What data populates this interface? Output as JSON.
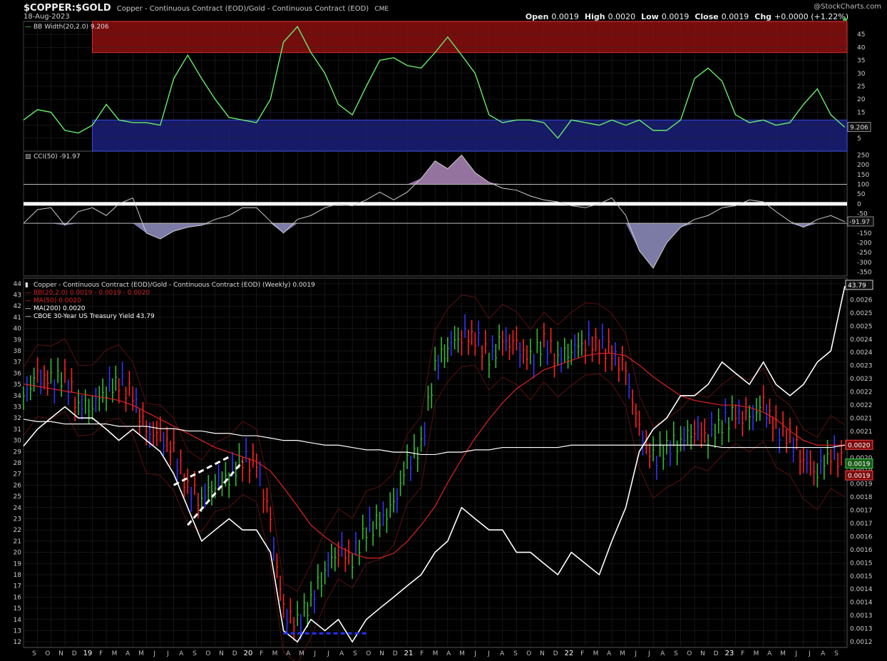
{
  "header": {
    "symbol": "$COPPER:$GOLD",
    "description": "Copper - Continuous Contract (EOD)/Gold - Continuous Contract (EOD)",
    "exchange": "CME",
    "date": "18-Aug-2023",
    "watermark": "@StockCharts.com",
    "quote": [
      {
        "label": "Open",
        "value": "0.0019"
      },
      {
        "label": "High",
        "value": "0.0020"
      },
      {
        "label": "Low",
        "value": "0.0019"
      },
      {
        "label": "Close",
        "value": "0.0019"
      },
      {
        "label": "Chg",
        "value": "+0.0000 (+1.22%)"
      }
    ]
  },
  "colors": {
    "background": "#000000",
    "grid": "#2a2a2a",
    "bbwidth_line": "#66ee66",
    "red_zone": "#8b1010",
    "blue_zone": "#1a1f7a",
    "cci_fill": "#8a88b8",
    "cci_line": "#cccccc",
    "bar_up": "#33bb33",
    "bar_down": "#ff2222",
    "bar_neutral": "#3333ff",
    "ma50": "#dd2222",
    "ma200": "#ffffff",
    "tyx": "#ffffff",
    "bbands": "#5a1010"
  },
  "chart_data": [
    {
      "type": "line",
      "panel": "BB Width",
      "legend": "BB Width(20,2.0) 9.206",
      "last_label": "9.206",
      "ylim": [
        0,
        50
      ],
      "yticks": [
        "5",
        "10",
        "15",
        "20",
        "25",
        "30",
        "35",
        "40",
        "45"
      ],
      "zones": [
        {
          "name": "high-volatility",
          "from": 38,
          "to": 50,
          "start_date": "2019-01"
        },
        {
          "name": "low-volatility",
          "from": 0,
          "to": 12,
          "start_date": "2019-01"
        }
      ],
      "series": [
        {
          "x": [
            "2018-08",
            "2018-09",
            "2018-10",
            "2018-11",
            "2018-12",
            "2019-01",
            "2019-02",
            "2019-03",
            "2019-04",
            "2019-05",
            "2019-06",
            "2019-07",
            "2019-08",
            "2019-09",
            "2019-10",
            "2019-11",
            "2019-12",
            "2020-01",
            "2020-02",
            "2020-03",
            "2020-04",
            "2020-05",
            "2020-06",
            "2020-07",
            "2020-08",
            "2020-09",
            "2020-10",
            "2020-11",
            "2020-12",
            "2021-01",
            "2021-02",
            "2021-03",
            "2021-04",
            "2021-05",
            "2021-06",
            "2021-07",
            "2021-08",
            "2021-09",
            "2021-10",
            "2021-11",
            "2021-12",
            "2022-01",
            "2022-02",
            "2022-03",
            "2022-04",
            "2022-05",
            "2022-06",
            "2022-07",
            "2022-08",
            "2022-09",
            "2022-10",
            "2022-11",
            "2022-12",
            "2023-01",
            "2023-02",
            "2023-03",
            "2023-04",
            "2023-05",
            "2023-06",
            "2023-07",
            "2023-08"
          ],
          "values": [
            12,
            16,
            15,
            8,
            7,
            10,
            18,
            12,
            11,
            11,
            10,
            28,
            37,
            28,
            20,
            13,
            12,
            11,
            20,
            42,
            48,
            38,
            30,
            18,
            14,
            25,
            35,
            36,
            33,
            32,
            38,
            44,
            37,
            30,
            14,
            11,
            12,
            12,
            11,
            5,
            12,
            11,
            10,
            12,
            10,
            12,
            8,
            8,
            12,
            28,
            32,
            27,
            14,
            11,
            12,
            10,
            11,
            18,
            24,
            14,
            9.206
          ]
        }
      ]
    },
    {
      "type": "area",
      "panel": "CCI",
      "legend": "CCI(50) -91.97",
      "last_label": "-91.97",
      "ylim": [
        -370,
        270
      ],
      "yticks": [
        "250",
        "200",
        "150",
        "100",
        "50",
        "0",
        "-50",
        "-100",
        "-150",
        "-200",
        "-250",
        "-300",
        "-350"
      ],
      "reference_lines": [
        100,
        0,
        -100
      ],
      "series": [
        {
          "x": [
            "2018-08",
            "2018-09",
            "2018-10",
            "2018-11",
            "2018-12",
            "2019-01",
            "2019-02",
            "2019-03",
            "2019-04",
            "2019-05",
            "2019-06",
            "2019-07",
            "2019-08",
            "2019-09",
            "2019-10",
            "2019-11",
            "2019-12",
            "2020-01",
            "2020-02",
            "2020-03",
            "2020-04",
            "2020-05",
            "2020-06",
            "2020-07",
            "2020-08",
            "2020-09",
            "2020-10",
            "2020-11",
            "2020-12",
            "2021-01",
            "2021-02",
            "2021-03",
            "2021-04",
            "2021-05",
            "2021-06",
            "2021-07",
            "2021-08",
            "2021-09",
            "2021-10",
            "2021-11",
            "2021-12",
            "2022-01",
            "2022-02",
            "2022-03",
            "2022-04",
            "2022-05",
            "2022-06",
            "2022-07",
            "2022-08",
            "2022-09",
            "2022-10",
            "2022-11",
            "2022-12",
            "2023-01",
            "2023-02",
            "2023-03",
            "2023-04",
            "2023-05",
            "2023-06",
            "2023-07",
            "2023-08"
          ],
          "values": [
            -100,
            -30,
            -20,
            -110,
            -40,
            -20,
            -60,
            0,
            30,
            -150,
            -180,
            -140,
            -120,
            -110,
            -80,
            -60,
            -20,
            -20,
            -90,
            -150,
            -80,
            -60,
            -20,
            0,
            -10,
            20,
            60,
            20,
            60,
            130,
            220,
            180,
            250,
            160,
            110,
            80,
            70,
            40,
            20,
            10,
            -10,
            -20,
            0,
            30,
            -60,
            -240,
            -330,
            -200,
            -120,
            -80,
            -60,
            -20,
            -10,
            20,
            10,
            -40,
            -90,
            -120,
            -80,
            -60,
            -91.97
          ]
        }
      ]
    },
    {
      "type": "bar",
      "panel": "Price",
      "legend": [
        {
          "text": "Copper - Continuous Contract (EOD)/Gold - Continuous Contract (EOD) (Weekly) 0.0019",
          "color": "#dddddd"
        },
        {
          "text": "BB(20,2.0) 0.0019 - 0.0019 - 0.0020",
          "color": "#cc2222"
        },
        {
          "text": "MA(50) 0.0020",
          "color": "#dd2222"
        },
        {
          "text": "MA(200) 0.0020",
          "color": "#ffffff"
        },
        {
          "text": "CBOE 30-Year US Treasury Yield 43.79",
          "color": "#ffffff"
        }
      ],
      "ylim_right": [
        0.00115,
        0.00272
      ],
      "right_ticks": [
        "0.0026",
        "0.0026",
        "0.0025",
        "0.0025",
        "0.0024",
        "0.0024",
        "0.0023",
        "0.0023",
        "0.0022",
        "0.0022",
        "0.0021",
        "0.0021",
        "0.0020",
        "0.0020",
        "0.0019",
        "0.0019",
        "0.0018",
        "0.0017",
        "0.0017",
        "0.0016",
        "0.0016",
        "0.0015",
        "0.0015",
        "0.0014",
        "0.0014",
        "0.0013",
        "0.0013",
        "0.0012"
      ],
      "ylim_left": [
        11.5,
        44.5
      ],
      "left_ticks": [
        "12",
        "13",
        "14",
        "15",
        "16",
        "17",
        "18",
        "19",
        "20",
        "21",
        "22",
        "23",
        "24",
        "25",
        "26",
        "27",
        "28",
        "29",
        "30",
        "31",
        "32",
        "33",
        "34",
        "35",
        "36",
        "37",
        "38",
        "39",
        "40",
        "41",
        "42",
        "43",
        "44"
      ],
      "right_labels": [
        {
          "text": "43.79",
          "value": 43.79,
          "axis": "left",
          "style": "white"
        },
        {
          "text": "0.0020",
          "value": 0.00201,
          "axis": "right",
          "style": "red"
        },
        {
          "text": "0.0019",
          "value": 0.00193,
          "axis": "right",
          "style": "green"
        },
        {
          "text": "0.0019",
          "value": 0.00188,
          "axis": "right",
          "style": "red"
        }
      ],
      "x": [
        "2018-08",
        "2018-09",
        "2018-10",
        "2018-11",
        "2018-12",
        "2019-01",
        "2019-02",
        "2019-03",
        "2019-04",
        "2019-05",
        "2019-06",
        "2019-07",
        "2019-08",
        "2019-09",
        "2019-10",
        "2019-11",
        "2019-12",
        "2020-01",
        "2020-02",
        "2020-03",
        "2020-04",
        "2020-05",
        "2020-06",
        "2020-07",
        "2020-08",
        "2020-09",
        "2020-10",
        "2020-11",
        "2020-12",
        "2021-01",
        "2021-02",
        "2021-03",
        "2021-04",
        "2021-05",
        "2021-06",
        "2021-07",
        "2021-08",
        "2021-09",
        "2021-10",
        "2021-11",
        "2021-12",
        "2022-01",
        "2022-02",
        "2022-03",
        "2022-04",
        "2022-05",
        "2022-06",
        "2022-07",
        "2022-08",
        "2022-09",
        "2022-10",
        "2022-11",
        "2022-12",
        "2023-01",
        "2023-02",
        "2023-03",
        "2023-04",
        "2023-05",
        "2023-06",
        "2023-07",
        "2023-08"
      ],
      "series": [
        {
          "name": "Copper/Gold",
          "values": [
            0.00222,
            0.0023,
            0.00228,
            0.0023,
            0.00218,
            0.00218,
            0.00225,
            0.00228,
            0.00222,
            0.00206,
            0.00205,
            0.00198,
            0.00183,
            0.00178,
            0.00185,
            0.00188,
            0.00195,
            0.00193,
            0.00168,
            0.0013,
            0.00125,
            0.00135,
            0.00148,
            0.00157,
            0.00153,
            0.00165,
            0.00168,
            0.00175,
            0.00193,
            0.002,
            0.00235,
            0.00243,
            0.00248,
            0.00247,
            0.00238,
            0.00245,
            0.00243,
            0.00237,
            0.00245,
            0.00238,
            0.00242,
            0.00245,
            0.00244,
            0.0024,
            0.00232,
            0.00207,
            0.00195,
            0.002,
            0.00203,
            0.00208,
            0.00205,
            0.0021,
            0.00214,
            0.00212,
            0.00218,
            0.00208,
            0.00205,
            0.00195,
            0.0019,
            0.00198,
            0.00193
          ]
        },
        {
          "name": "MA(50)",
          "values": [
            0.00227,
            0.00226,
            0.00225,
            0.00224,
            0.00223,
            0.00222,
            0.00221,
            0.0022,
            0.00218,
            0.00215,
            0.00212,
            0.00209,
            0.00206,
            0.00203,
            0.002,
            0.00198,
            0.00196,
            0.00194,
            0.0019,
            0.00183,
            0.00175,
            0.00167,
            0.00162,
            0.00158,
            0.00155,
            0.00153,
            0.00153,
            0.00155,
            0.0016,
            0.00167,
            0.00175,
            0.00185,
            0.00195,
            0.00204,
            0.00212,
            0.00219,
            0.00225,
            0.00229,
            0.00233,
            0.00235,
            0.00237,
            0.00239,
            0.0024,
            0.0024,
            0.00239,
            0.00235,
            0.0023,
            0.00226,
            0.00222,
            0.0022,
            0.00219,
            0.00218,
            0.00218,
            0.00217,
            0.00215,
            0.00212,
            0.00207,
            0.00203,
            0.00201,
            0.00201,
            0.00201
          ]
        },
        {
          "name": "MA(200)",
          "values": [
            0.00212,
            0.00211,
            0.00211,
            0.0021,
            0.0021,
            0.0021,
            0.0021,
            0.00209,
            0.00209,
            0.00209,
            0.00208,
            0.00208,
            0.00207,
            0.00207,
            0.00206,
            0.00206,
            0.00205,
            0.00205,
            0.00204,
            0.00203,
            0.00203,
            0.00202,
            0.00201,
            0.00201,
            0.002,
            0.00199,
            0.00199,
            0.00198,
            0.00198,
            0.00197,
            0.00197,
            0.00198,
            0.00198,
            0.00199,
            0.00199,
            0.002,
            0.002,
            0.002,
            0.002,
            0.002,
            0.00201,
            0.00201,
            0.00201,
            0.00201,
            0.00201,
            0.00201,
            0.00201,
            0.00201,
            0.00201,
            0.00201,
            0.00201,
            0.002,
            0.002,
            0.002,
            0.002,
            0.002,
            0.002,
            0.002,
            0.002,
            0.002,
            0.00201
          ]
        },
        {
          "name": "CBOE 30-Year US Treasury Yield",
          "axis": "left",
          "values": [
            29.5,
            31,
            32,
            33,
            32,
            32,
            31,
            30,
            31,
            30,
            29,
            27,
            24,
            21,
            22,
            23,
            22,
            22,
            20,
            13,
            12,
            14,
            13,
            14,
            12,
            14,
            15,
            16,
            17,
            18,
            20,
            21,
            24,
            23,
            22,
            22,
            20,
            20,
            19,
            18,
            20,
            19,
            18,
            21,
            24,
            29,
            31,
            32,
            34,
            34,
            35,
            37,
            36,
            35,
            37,
            35,
            34,
            35,
            37,
            38,
            43.79
          ]
        }
      ],
      "annotations": [
        "rising wedge (2019-08 to 2019-12)",
        "support line at 2020 low"
      ]
    }
  ],
  "x_axis": {
    "labels": [
      "S",
      "O",
      "N",
      "D",
      "19",
      "F",
      "M",
      "A",
      "M",
      "J",
      "J",
      "A",
      "S",
      "O",
      "N",
      "D",
      "20",
      "F",
      "M",
      "A",
      "M",
      "J",
      "J",
      "A",
      "S",
      "O",
      "N",
      "D",
      "21",
      "F",
      "M",
      "A",
      "M",
      "J",
      "J",
      "A",
      "S",
      "O",
      "N",
      "D",
      "22",
      "F",
      "M",
      "A",
      "M",
      "J",
      "J",
      "A",
      "S",
      "O",
      "N",
      "D",
      "23",
      "F",
      "M",
      "A",
      "M",
      "J",
      "J",
      "A",
      "S"
    ],
    "year_labels": [
      "19",
      "20",
      "21",
      "22",
      "23"
    ]
  }
}
